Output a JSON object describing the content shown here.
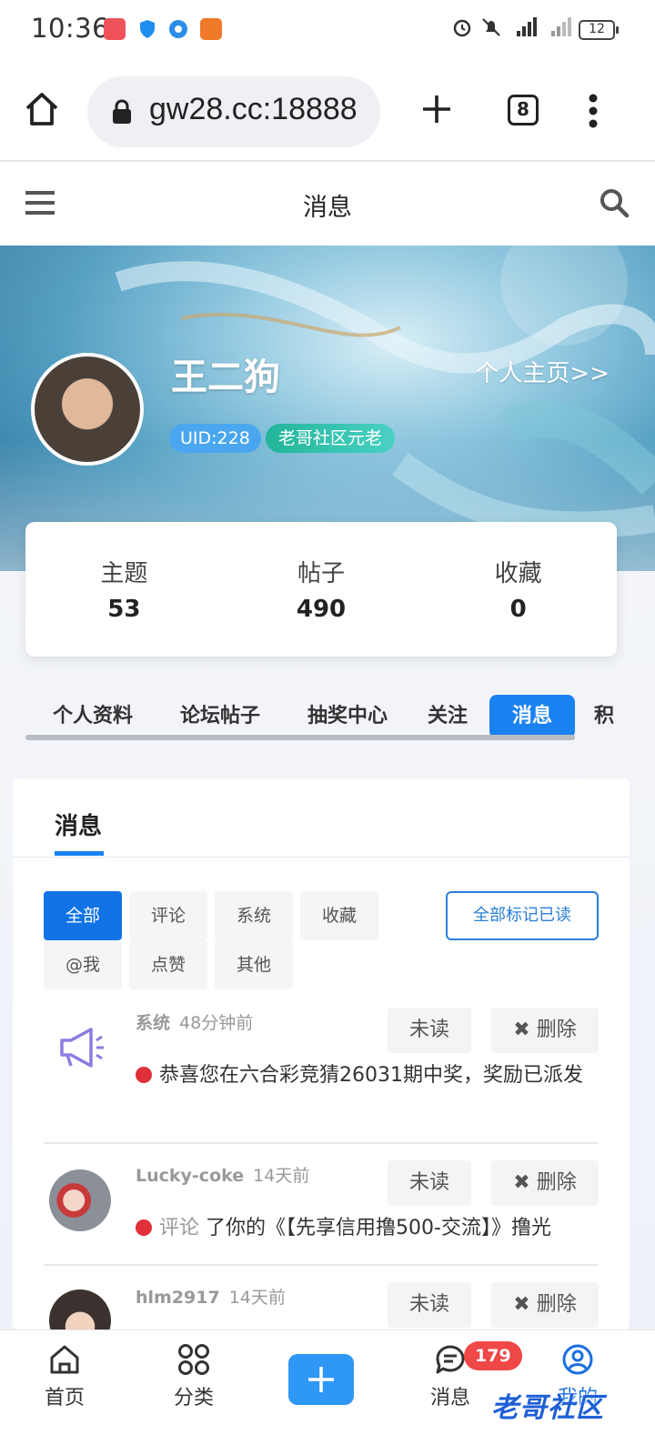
{
  "status_bar": {
    "time": "10:36",
    "battery": "12"
  },
  "browser": {
    "url": "gw28.cc:18888",
    "tab_count": "8"
  },
  "header": {
    "title": "消息"
  },
  "profile": {
    "name": "王二狗",
    "home_link": "个人主页>>",
    "uid": "UID:228",
    "rank": "老哥社区元老"
  },
  "stats": [
    {
      "label": "主题",
      "value": "53"
    },
    {
      "label": "帖子",
      "value": "490"
    },
    {
      "label": "收藏",
      "value": "0"
    }
  ],
  "profile_tabs": [
    "个人资料",
    "论坛帖子",
    "抽奖中心",
    "关注",
    "消息",
    "积"
  ],
  "panel": {
    "title": "消息",
    "filters": [
      "全部",
      "评论",
      "系统",
      "收藏",
      "@我",
      "点赞",
      "其他"
    ],
    "mark_all_read": "全部标记已读"
  },
  "messages": [
    {
      "sender": "系统",
      "time": "48分钟前",
      "unread_label": "未读",
      "delete_label": "删除",
      "text": "恭喜您在六合彩竞猜26031期中奖，奖励已派发"
    },
    {
      "sender": "Lucky-coke",
      "time": "14天前",
      "unread_label": "未读",
      "delete_label": "删除",
      "prefix": "评论",
      "text": "了你的《【先享信用撸500-交流】》撸光"
    },
    {
      "sender": "hlm2917",
      "time": "14天前",
      "unread_label": "未读",
      "delete_label": "删除"
    }
  ],
  "bottom_nav": {
    "home": "首页",
    "category": "分类",
    "messages": "消息",
    "messages_badge": "179",
    "mine": "我的",
    "watermark": "老哥社区"
  },
  "colors": {
    "accent": "#1a82f0",
    "badge_red": "#f04747",
    "unread_dot": "#e0303a"
  }
}
